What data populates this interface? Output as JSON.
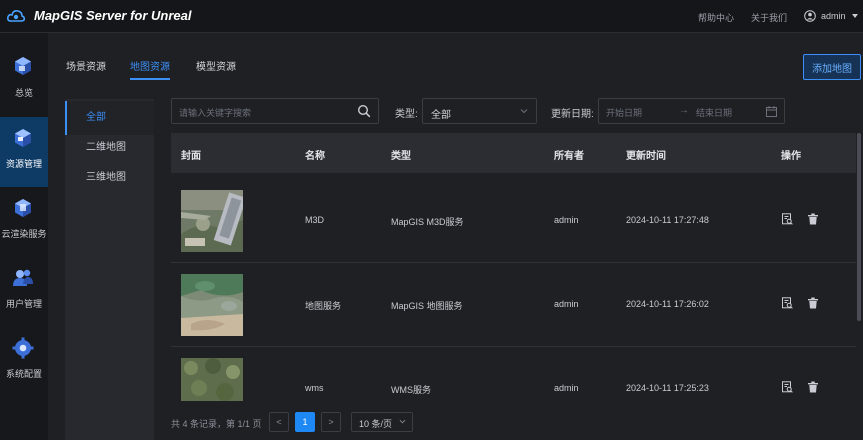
{
  "app": {
    "title": "MapGIS Server for Unreal"
  },
  "header": {
    "help": "帮助中心",
    "about": "关于我们",
    "user": "admin"
  },
  "sidebar": {
    "items": [
      {
        "label": "总览",
        "icon": "overview-cube-icon"
      },
      {
        "label": "资源管理",
        "icon": "resource-cube-icon",
        "active": true
      },
      {
        "label": "云渲染服务",
        "icon": "cloud-render-cube-icon"
      },
      {
        "label": "用户管理",
        "icon": "users-icon"
      },
      {
        "label": "系统配置",
        "icon": "settings-gear-icon"
      }
    ]
  },
  "tabs": [
    {
      "label": "场景资源"
    },
    {
      "label": "地图资源",
      "active": true
    },
    {
      "label": "模型资源"
    }
  ],
  "add_button": "添加地图",
  "categories": [
    {
      "label": "全部",
      "active": true
    },
    {
      "label": "二维地图"
    },
    {
      "label": "三维地图"
    }
  ],
  "search": {
    "placeholder": "请输入关键字搜索"
  },
  "filters": {
    "type_label": "类型:",
    "type_value": "全部",
    "date_label": "更新日期:",
    "start_placeholder": "开始日期",
    "end_placeholder": "结束日期",
    "arrow": "→"
  },
  "table": {
    "headers": [
      "封面",
      "名称",
      "类型",
      "所有者",
      "更新时间",
      "操作"
    ],
    "rows": [
      {
        "name": "M3D",
        "type": "MapGIS M3D服务",
        "owner": "admin",
        "updated": "2024-10-11 17:27:48",
        "thumb": "aerial-buildings"
      },
      {
        "name": "地图服务",
        "type": "MapGIS 地图服务",
        "owner": "admin",
        "updated": "2024-10-11 17:26:02",
        "thumb": "satellite-terrain"
      },
      {
        "name": "wms",
        "type": "WMS服务",
        "owner": "admin",
        "updated": "2024-10-11 17:25:23",
        "thumb": "forest-texture"
      }
    ]
  },
  "pagination": {
    "summary": "共 4 条记录，第 1/1 页",
    "prev": "<",
    "current": "1",
    "next": ">",
    "page_size": "10 条/页"
  },
  "colors": {
    "accent": "#1e88f5",
    "background": "#1f2024",
    "sidebar_active": "#0e3a66"
  }
}
